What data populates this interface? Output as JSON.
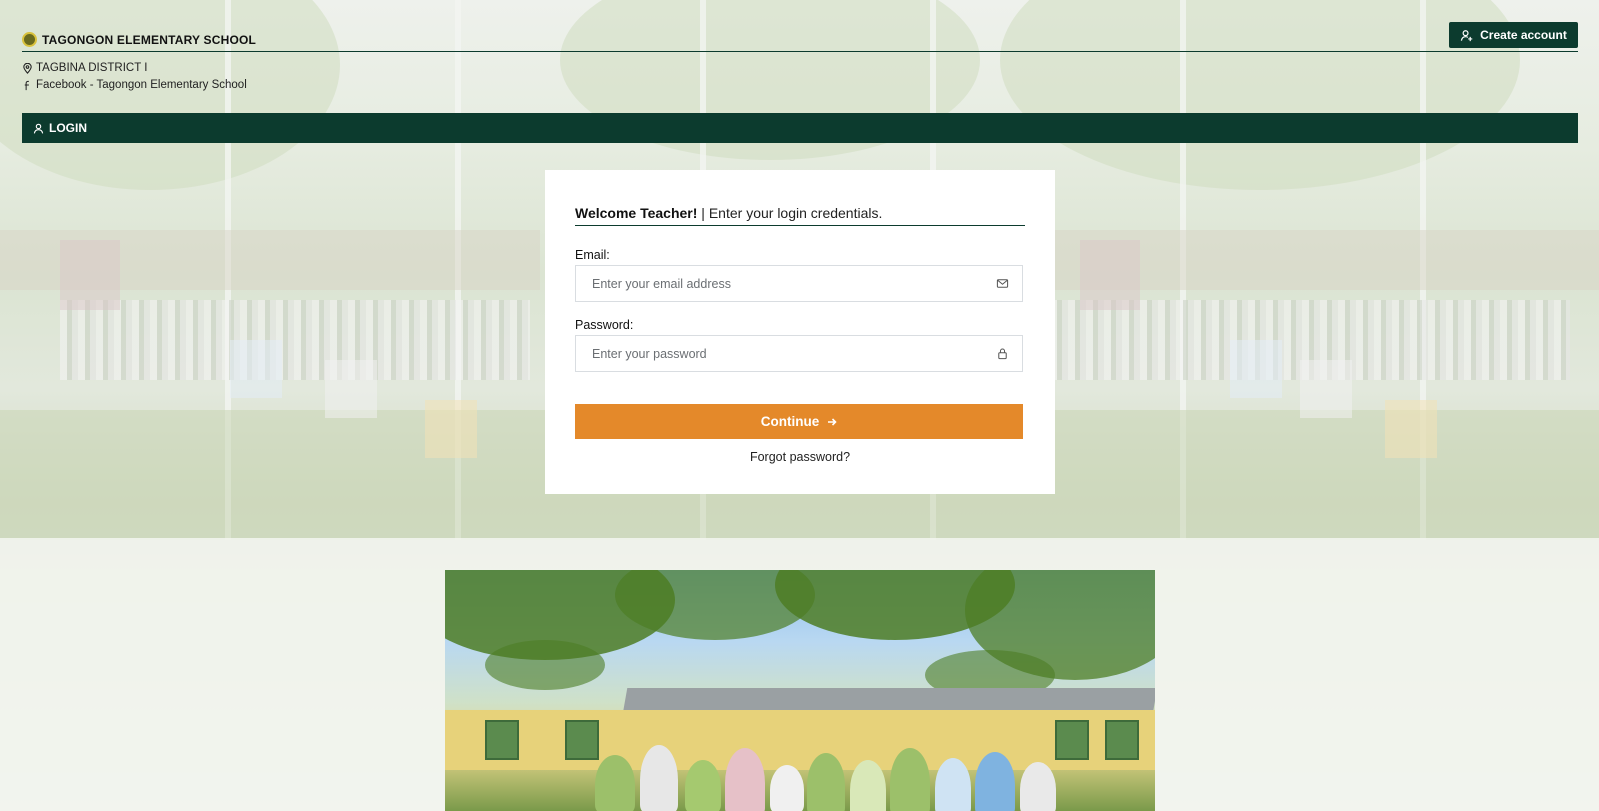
{
  "header": {
    "school_name": "TAGONGON ELEMENTARY SCHOOL",
    "district": "TAGBINA DISTRICT I",
    "facebook": "Facebook - Tagongon Elementary School",
    "create_account_label": "Create account"
  },
  "nav": {
    "login_label": "LOGIN"
  },
  "login": {
    "welcome_bold": "Welcome Teacher!",
    "welcome_rest": " | Enter your login credentials.",
    "email_label": "Email:",
    "email_placeholder": "Enter your email address",
    "password_label": "Password:",
    "password_placeholder": "Enter your password",
    "continue_label": "Continue",
    "forgot_label": "Forgot password?"
  },
  "icons": {
    "logo": "school-logo",
    "location": "map-pin-icon",
    "facebook": "facebook-icon",
    "create_account": "user-plus-icon",
    "login": "user-icon",
    "email": "mail-icon",
    "password": "lock-icon",
    "continue": "arrow-right-icon"
  },
  "colors": {
    "primary": "#0c3b2e",
    "accent": "#e4892a"
  }
}
